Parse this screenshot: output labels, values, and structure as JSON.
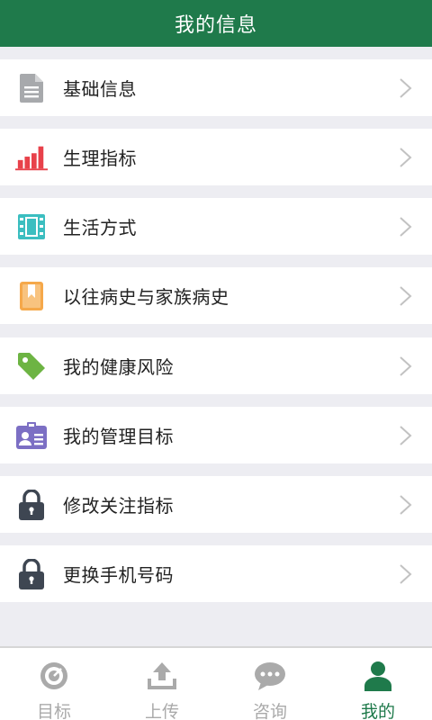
{
  "header": {
    "title": "我的信息"
  },
  "menu": [
    {
      "label": "基础信息",
      "icon": "document-icon",
      "color": "#a7a9ac"
    },
    {
      "label": "生理指标",
      "icon": "bar-chart-icon",
      "color": "#e8414a"
    },
    {
      "label": "生活方式",
      "icon": "film-icon",
      "color": "#3bbec0"
    },
    {
      "label": "以往病史与家族病史",
      "icon": "book-bookmark-icon",
      "color": "#f5a84a"
    },
    {
      "label": "我的健康风险",
      "icon": "tag-icon",
      "color": "#6db443"
    },
    {
      "label": "我的管理目标",
      "icon": "id-card-icon",
      "color": "#7c6fc4"
    },
    {
      "label": "修改关注指标",
      "icon": "lock-icon",
      "color": "#3e4652"
    },
    {
      "label": "更换手机号码",
      "icon": "lock-icon",
      "color": "#3e4652"
    }
  ],
  "tabbar": {
    "tabs": [
      {
        "label": "目标",
        "icon": "target-icon",
        "active": false
      },
      {
        "label": "上传",
        "icon": "upload-icon",
        "active": false
      },
      {
        "label": "咨询",
        "icon": "chat-icon",
        "active": false
      },
      {
        "label": "我的",
        "icon": "user-icon",
        "active": true
      }
    ]
  },
  "colors": {
    "header": "#1f7a4b",
    "active_tab": "#1f7a4b",
    "inactive_tab": "#aaaaaa",
    "background": "#ededf2"
  }
}
